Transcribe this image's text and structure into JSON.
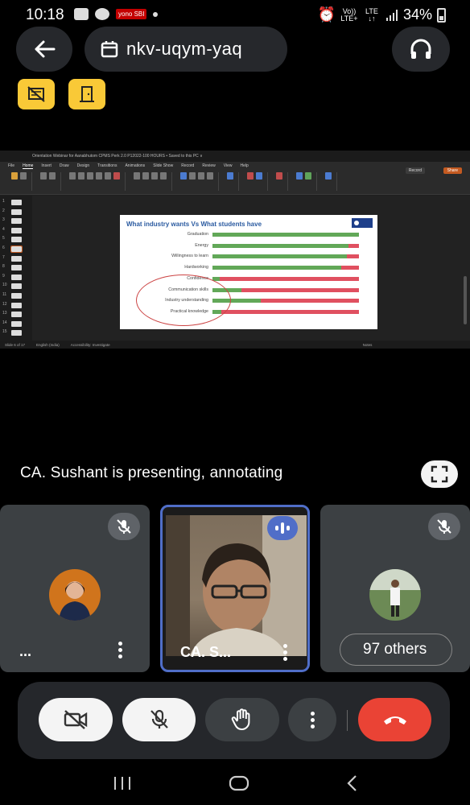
{
  "status_bar": {
    "time": "10:18",
    "badge": "yono SBI",
    "volte_1": "Vo)) LTE+",
    "volte_2": "LTE ↓↑",
    "battery": "34%"
  },
  "meeting": {
    "code": "nkv-uqym-yaq"
  },
  "ppt": {
    "title_bar": "Orientation Webinar for Aanabhutom CPMS Perk 2.0 P12022-100 HOURS  •  Saved to this PC ∨",
    "menu": [
      "File",
      "Home",
      "Insert",
      "Draw",
      "Design",
      "Transitions",
      "Animations",
      "Slide Show",
      "Record",
      "Review",
      "View",
      "Help"
    ],
    "record_label": "Record",
    "share_label": "Share",
    "status": [
      "Slide 6 of 17",
      "English (India)",
      "Accessibility: Investigate",
      "Notes"
    ],
    "slide_numbers": [
      "1",
      "2",
      "3",
      "4",
      "5",
      "6",
      "7",
      "8",
      "9",
      "10",
      "11",
      "12",
      "13",
      "14",
      "15"
    ]
  },
  "slide": {
    "title": "What industry wants Vs What students have"
  },
  "chart_data": {
    "type": "bar",
    "orientation": "horizontal-stacked",
    "categories": [
      "Graduation",
      "Energy",
      "Willingness to learn",
      "Hardworking",
      "Confidence",
      "Communication skills",
      "Industry understanding",
      "Practical knowledge"
    ],
    "series": [
      {
        "values": [
          100,
          93,
          92,
          88,
          5,
          20,
          33,
          6
        ],
        "color": "#62a858"
      },
      {
        "values": [
          0,
          7,
          8,
          12,
          95,
          80,
          67,
          94
        ],
        "color": "#e05060"
      }
    ],
    "xlim": [
      0,
      100
    ]
  },
  "presenting_text": "CA. Sushant is presenting, annotating",
  "participants": {
    "tile1_name": "...",
    "tile2_name": "CA. S...",
    "others": "97 others"
  }
}
